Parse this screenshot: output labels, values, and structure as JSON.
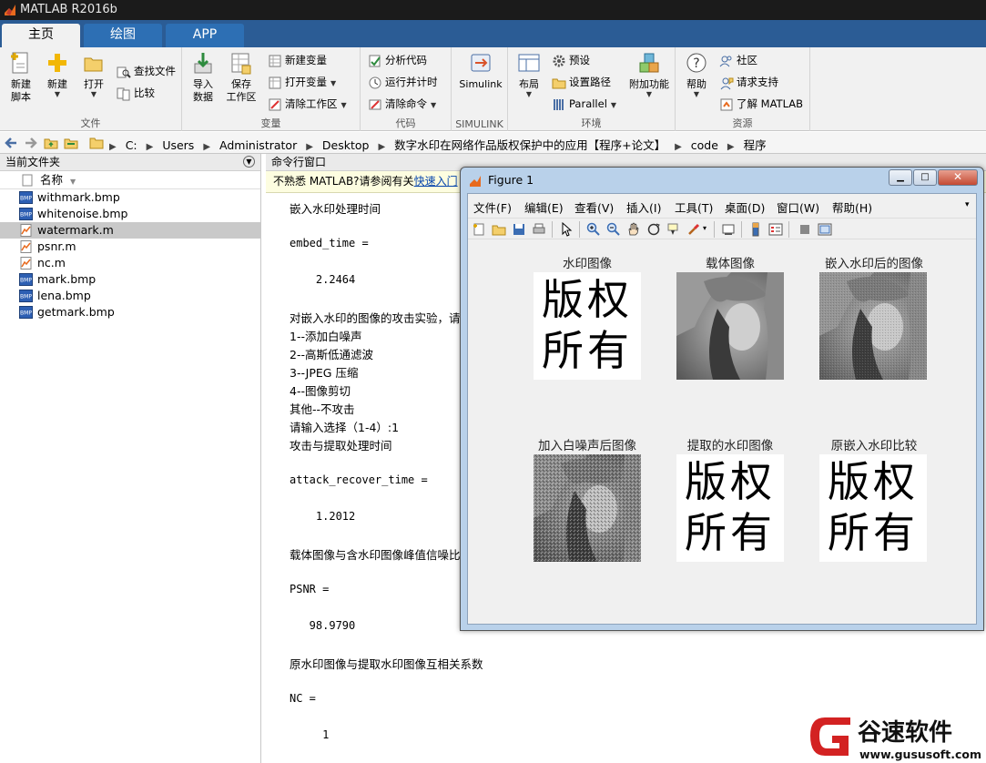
{
  "window": {
    "title": "MATLAB R2016b"
  },
  "tabs": [
    {
      "label": "主页"
    },
    {
      "label": "绘图"
    },
    {
      "label": "APP"
    }
  ],
  "ribbon": {
    "groups": {
      "file": "文件",
      "variable": "变量",
      "code": "代码",
      "simulink": "SIMULINK",
      "environment": "环境",
      "resources": "资源"
    },
    "new_script": [
      "新建",
      "脚本"
    ],
    "new": "新建",
    "open": "打开",
    "find_files": "查找文件",
    "compare": "比较",
    "import_data": [
      "导入",
      "数据"
    ],
    "save_workspace": [
      "保存",
      "工作区"
    ],
    "new_variable": "新建变量",
    "open_variable": "打开变量",
    "clear_workspace": "清除工作区",
    "analyze_code": "分析代码",
    "run_and_time": "运行并计时",
    "clear_commands": "清除命令",
    "simulink": "Simulink",
    "layout": "布局",
    "preferences": "预设",
    "set_path": "设置路径",
    "parallel": "Parallel",
    "addons": "附加功能",
    "help": "帮助",
    "community": "社区",
    "request_support": "请求支持",
    "learn_matlab": "了解 MATLAB"
  },
  "address": {
    "crumbs": [
      "C:",
      "Users",
      "Administrator",
      "Desktop",
      "数字水印在网络作品版权保护中的应用【程序+论文】",
      "code",
      "程序"
    ]
  },
  "current_folder": {
    "title": "当前文件夹",
    "column_name": "名称",
    "files": [
      {
        "name": "withmark.bmp",
        "type": "bmp"
      },
      {
        "name": "whitenoise.bmp",
        "type": "bmp"
      },
      {
        "name": "watermark.m",
        "type": "m",
        "selected": true
      },
      {
        "name": "psnr.m",
        "type": "m"
      },
      {
        "name": "nc.m",
        "type": "m"
      },
      {
        "name": "mark.bmp",
        "type": "bmp"
      },
      {
        "name": "lena.bmp",
        "type": "bmp"
      },
      {
        "name": "getmark.bmp",
        "type": "bmp"
      }
    ]
  },
  "command_window": {
    "title": "命令行窗口",
    "notice_text": "不熟悉 MATLAB?请参阅有关",
    "notice_link": "快速入门",
    "lines": [
      "嵌入水印处理时间",
      "embed_time =",
      "    2.2464",
      "对嵌入水印的图像的攻击实验，请",
      "1--添加白噪声",
      "2--高斯低通滤波",
      "3--JPEG 压缩",
      "4--图像剪切",
      "其他--不攻击",
      "请输入选择（1-4）:1",
      "攻击与提取处理时间",
      "attack_recover_time =",
      "    1.2012",
      "载体图像与含水印图像峰值信噪比",
      "PSNR =",
      "   98.9790",
      "原水印图像与提取水印图像互相关系数",
      "NC =",
      "     1"
    ]
  },
  "figure": {
    "title": "Figure 1",
    "menu": [
      "文件(F)",
      "编辑(E)",
      "查看(V)",
      "插入(I)",
      "工具(T)",
      "桌面(D)",
      "窗口(W)",
      "帮助(H)"
    ],
    "plots": [
      {
        "title": "水印图像",
        "kind": "watermark"
      },
      {
        "title": "载体图像",
        "kind": "lena"
      },
      {
        "title": "嵌入水印后的图像",
        "kind": "lena"
      },
      {
        "title": "加入白噪声后图像",
        "kind": "noisy"
      },
      {
        "title": "提取的水印图像",
        "kind": "watermark"
      },
      {
        "title": "原嵌入水印比较",
        "kind": "watermark"
      }
    ],
    "watermark_chars": [
      "版",
      "权",
      "所",
      "有"
    ]
  },
  "brand": {
    "name": "谷速软件",
    "url": "www.gususoft.com",
    "color": "#d32222"
  }
}
